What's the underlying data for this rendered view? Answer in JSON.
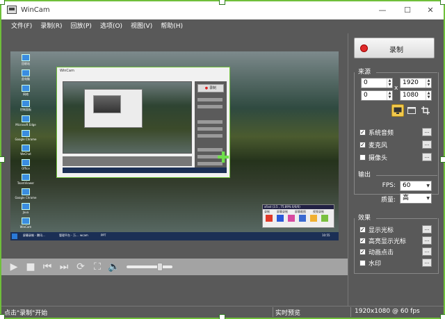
{
  "window": {
    "title": "WinCam",
    "minimize": "—",
    "maximize": "☐",
    "close": "✕"
  },
  "menu": [
    "文件(F)",
    "录制(R)",
    "回放(P)",
    "选项(O)",
    "视图(V)",
    "帮助(H)"
  ],
  "preview": {
    "desktop_icons": [
      "回收站",
      "此电脑",
      "网络",
      "控制面板",
      "Microsoft Edge",
      "Google Chrome",
      "WeChat",
      "Office",
      "TeamViewer",
      "Google Chrome",
      "Java",
      "WinCam"
    ],
    "nested_title": "WinCam",
    "nested_record": "录制",
    "widget_title": "xFast (3.5 , 75.89% 0/0/0)",
    "widget_tabs": [
      "录制",
      "屏幕录制",
      "屏幕截图",
      "视频录制"
    ],
    "taskbar_items": [
      "屏幕录制 - 腾讯...",
      "管理平台 - 万...",
      "wcam",
      "PPT"
    ],
    "taskbar_time": "10:55"
  },
  "controls": {
    "play_icon": "▶",
    "stop_icon": "■",
    "prev_icon": "⏮",
    "next_icon": "⏭",
    "loop_icon": "⟳",
    "fullscreen_icon": "⛶",
    "volume_icon": "🔈",
    "seek_position": 0.76
  },
  "panel": {
    "record_label": "录制",
    "source": {
      "title": "来源",
      "x": "0",
      "y": "0",
      "width": "1920",
      "height": "1080",
      "times": "x"
    },
    "source_options": [
      {
        "label": "系统音频",
        "checked": true
      },
      {
        "label": "麦克风",
        "checked": true
      },
      {
        "label": "摄像头",
        "checked": false
      }
    ],
    "output": {
      "title": "输出",
      "fps_label": "FPS:",
      "fps_value": "60",
      "quality_label": "质量:",
      "quality_value": "高"
    },
    "effects": {
      "title": "效果",
      "items": [
        {
          "label": "显示光标",
          "checked": true
        },
        {
          "label": "高亮显示光标",
          "checked": true
        },
        {
          "label": "动画点击",
          "checked": true
        },
        {
          "label": "水印",
          "checked": false
        }
      ]
    },
    "dots": "..."
  },
  "status": {
    "hint": "点击\"录制\"开始",
    "mode": "实时预览",
    "resolution": "1920x1080 @ 60 fps"
  },
  "colors": {
    "accent": "#6fbf3a",
    "record": "#e02a2a",
    "background": "#595959"
  }
}
